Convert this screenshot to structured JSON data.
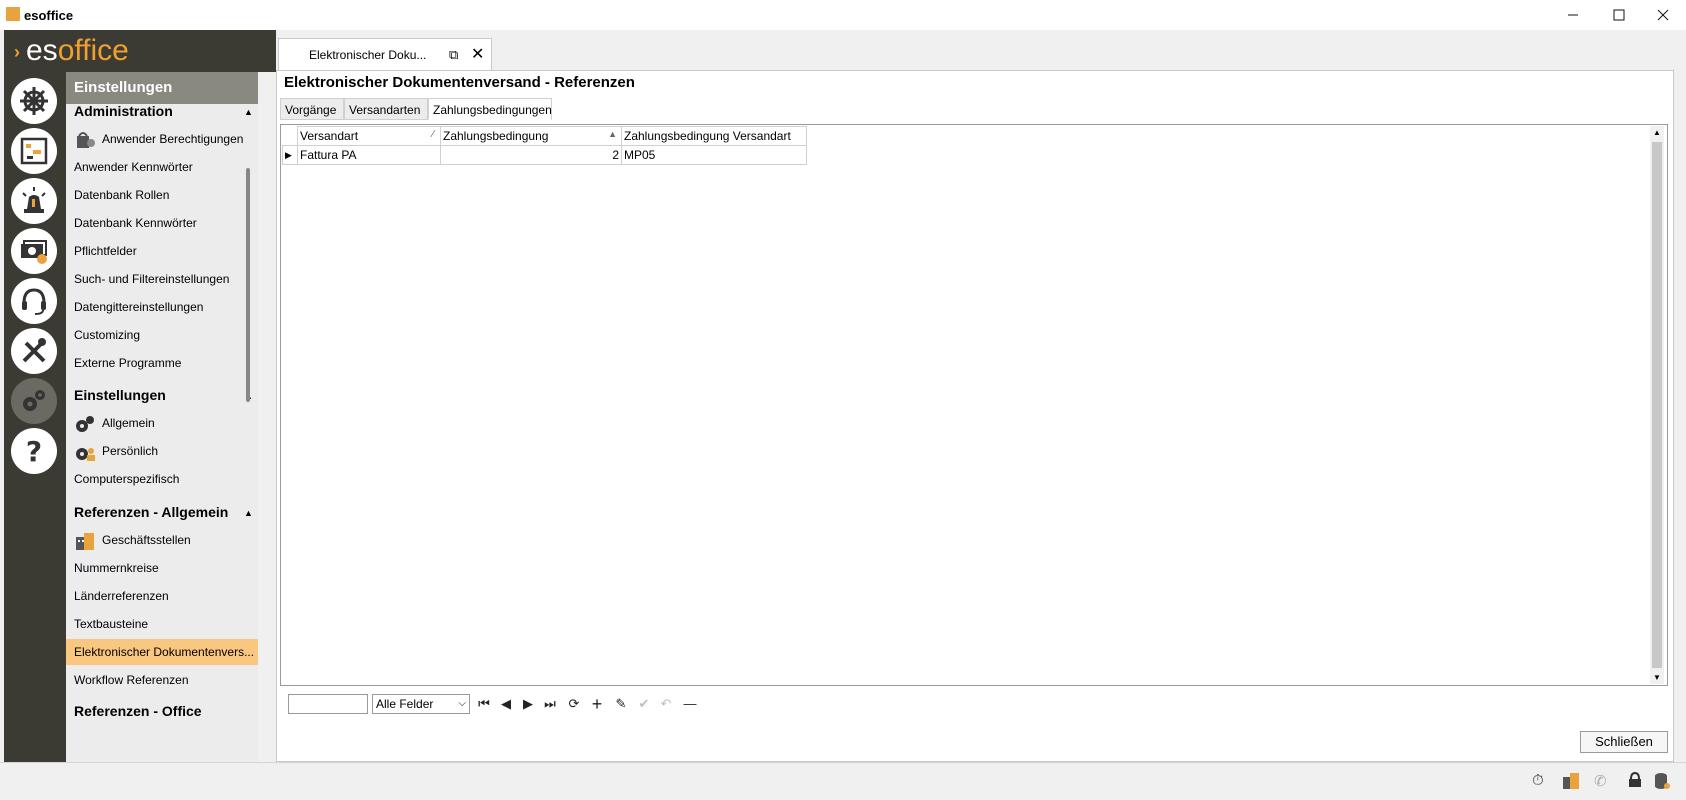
{
  "window": {
    "title": "esoffice",
    "minimize_icon": "minimize-icon",
    "maximize_icon": "maximize-icon",
    "close_icon": "close-icon"
  },
  "logo": {
    "prefix": "es",
    "suffix": "office"
  },
  "colors": {
    "accent": "#f0a030",
    "nav_bg": "#3b3a33",
    "selected_item": "#f9c77f"
  },
  "sidebar": {
    "title": "Einstellungen",
    "sections": [
      {
        "title": "Administration",
        "items": [
          "Anwender Berechtigungen",
          "Anwender Kennwörter",
          "Datenbank Rollen",
          "Datenbank Kennwörter",
          "Pflichtfelder",
          "Such- und Filtereinstellungen",
          "Datengittereinstellungen",
          "Customizing",
          "Externe Programme"
        ]
      },
      {
        "title": "Einstellungen",
        "items": [
          "Allgemein",
          "Persönlich",
          "Computerspezifisch"
        ]
      },
      {
        "title": "Referenzen - Allgemein",
        "items": [
          "Geschäftsstellen",
          "Nummernkreise",
          "Länderreferenzen",
          "Textbausteine",
          "Elektronischer Dokumentenvers...",
          "Workflow Referenzen"
        ]
      }
    ],
    "cut_off_section": "Referenzen - Office"
  },
  "doc_tab": {
    "label": "Elektronischer Doku..."
  },
  "page": {
    "title": "Elektronischer Dokumentenversand - Referenzen",
    "subtabs": [
      "Vorgänge",
      "Versandarten",
      "Zahlungsbedingungen"
    ],
    "active_subtab": "Zahlungsbedingungen"
  },
  "grid": {
    "columns": [
      "Versandart",
      "Zahlungsbedingung",
      "Zahlungsbedingung Versandart"
    ],
    "rows": [
      {
        "versandart": "Fattura PA",
        "zahlungsbedingung": "2",
        "zb_versandart": "MP05"
      }
    ]
  },
  "toolbar": {
    "search_value": "",
    "field_select": "Alle Felder"
  },
  "footer": {
    "close_label": "Schließen"
  }
}
